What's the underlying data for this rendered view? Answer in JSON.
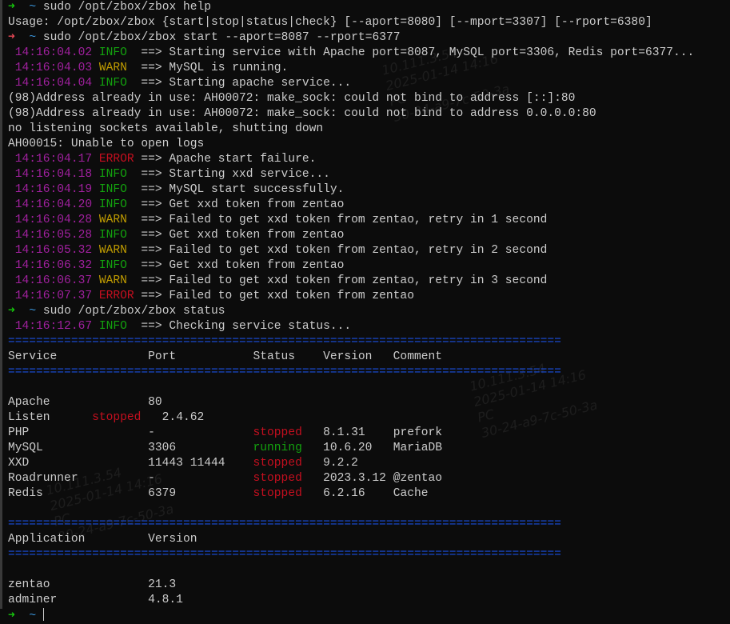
{
  "colors": {
    "background": "#0c0c0c",
    "text": "#cccccc",
    "timestamp": "#a0209e",
    "info": "#13a10e",
    "warn": "#c19c00",
    "error": "#c50f1f",
    "prompt_ok": "#16c60c",
    "prompt_fail": "#e74856",
    "separator": "#1a4fe0"
  },
  "watermark": [
    "10.111.3.54",
    "2025-01-14 14:16",
    "PC",
    "30-24-a9-7c-50-3a"
  ],
  "lines": [
    [
      {
        "c": "ok",
        "t": "➜"
      },
      {
        "c": "",
        "t": "  "
      },
      {
        "c": "cyan",
        "t": "~"
      },
      {
        "c": "",
        "t": " sudo /opt/zbox/zbox help"
      }
    ],
    [
      {
        "c": "",
        "t": "Usage: /opt/zbox/zbox {start|stop|status|check} [--aport=8080] [--mport=3307] [--rport=6380]"
      }
    ],
    [
      {
        "c": "fail",
        "t": "➜"
      },
      {
        "c": "",
        "t": "  "
      },
      {
        "c": "cyan",
        "t": "~"
      },
      {
        "c": "",
        "t": " sudo /opt/zbox/zbox start --aport=8087 --rport=6377"
      }
    ],
    [
      {
        "c": "ts",
        "t": " 14:16:04.02"
      },
      {
        "c": "info",
        "t": " INFO "
      },
      {
        "c": "",
        "t": " ==> Starting service with Apache port=8087, MySQL port=3306, Redis port=6377..."
      }
    ],
    [
      {
        "c": "ts",
        "t": " 14:16:04.03"
      },
      {
        "c": "warn",
        "t": " WARN "
      },
      {
        "c": "",
        "t": " ==> MySQL is running."
      }
    ],
    [
      {
        "c": "ts",
        "t": " 14:16:04.04"
      },
      {
        "c": "info",
        "t": " INFO "
      },
      {
        "c": "",
        "t": " ==> Starting apache service..."
      }
    ],
    [
      {
        "c": "",
        "t": "(98)Address already in use: AH00072: make_sock: could not bind to address [::]:80"
      }
    ],
    [
      {
        "c": "",
        "t": "(98)Address already in use: AH00072: make_sock: could not bind to address 0.0.0.0:80"
      }
    ],
    [
      {
        "c": "",
        "t": "no listening sockets available, shutting down"
      }
    ],
    [
      {
        "c": "",
        "t": "AH00015: Unable to open logs"
      }
    ],
    [
      {
        "c": "ts",
        "t": " 14:16:04.17"
      },
      {
        "c": "error",
        "t": " ERROR"
      },
      {
        "c": "",
        "t": " ==> Apache start failure."
      }
    ],
    [
      {
        "c": "ts",
        "t": " 14:16:04.18"
      },
      {
        "c": "info",
        "t": " INFO "
      },
      {
        "c": "",
        "t": " ==> Starting xxd service..."
      }
    ],
    [
      {
        "c": "ts",
        "t": " 14:16:04.19"
      },
      {
        "c": "info",
        "t": " INFO "
      },
      {
        "c": "",
        "t": " ==> MySQL start successfully."
      }
    ],
    [
      {
        "c": "ts",
        "t": " 14:16:04.20"
      },
      {
        "c": "info",
        "t": " INFO "
      },
      {
        "c": "",
        "t": " ==> Get xxd token from zentao"
      }
    ],
    [
      {
        "c": "ts",
        "t": " 14:16:04.28"
      },
      {
        "c": "warn",
        "t": " WARN "
      },
      {
        "c": "",
        "t": " ==> Failed to get xxd token from zentao, retry in 1 second"
      }
    ],
    [
      {
        "c": "ts",
        "t": " 14:16:05.28"
      },
      {
        "c": "info",
        "t": " INFO "
      },
      {
        "c": "",
        "t": " ==> Get xxd token from zentao"
      }
    ],
    [
      {
        "c": "ts",
        "t": " 14:16:05.32"
      },
      {
        "c": "warn",
        "t": " WARN "
      },
      {
        "c": "",
        "t": " ==> Failed to get xxd token from zentao, retry in 2 second"
      }
    ],
    [
      {
        "c": "ts",
        "t": " 14:16:06.32"
      },
      {
        "c": "info",
        "t": " INFO "
      },
      {
        "c": "",
        "t": " ==> Get xxd token from zentao"
      }
    ],
    [
      {
        "c": "ts",
        "t": " 14:16:06.37"
      },
      {
        "c": "warn",
        "t": " WARN "
      },
      {
        "c": "",
        "t": " ==> Failed to get xxd token from zentao, retry in 3 second"
      }
    ],
    [
      {
        "c": "ts",
        "t": " 14:16:07.37"
      },
      {
        "c": "error",
        "t": " ERROR"
      },
      {
        "c": "",
        "t": " ==> Failed to get xxd token from zentao"
      }
    ],
    [
      {
        "c": "ok",
        "t": "➜"
      },
      {
        "c": "",
        "t": "  "
      },
      {
        "c": "cyan",
        "t": "~"
      },
      {
        "c": "",
        "t": " sudo /opt/zbox/zbox status"
      }
    ],
    [
      {
        "c": "ts",
        "t": " 14:16:12.67"
      },
      {
        "c": "info",
        "t": " INFO "
      },
      {
        "c": "",
        "t": " ==> Checking service status..."
      }
    ],
    [
      {
        "c": "sep",
        "t": "==============================================================================="
      }
    ],
    [
      {
        "c": "",
        "t": "Service             Port           Status    Version   Comment"
      }
    ],
    [
      {
        "c": "sep",
        "t": "==============================================================================="
      }
    ],
    [
      {
        "c": "",
        "t": ""
      }
    ],
    [
      {
        "c": "",
        "t": "Apache              80"
      }
    ],
    [
      {
        "c": "",
        "t": "Listen      "
      },
      {
        "c": "stop",
        "t": "stopped"
      },
      {
        "c": "",
        "t": "   2.4.62"
      }
    ],
    [
      {
        "c": "",
        "t": "PHP                 -              "
      },
      {
        "c": "stop",
        "t": "stopped"
      },
      {
        "c": "",
        "t": "   8.1.31    prefork"
      }
    ],
    [
      {
        "c": "",
        "t": "MySQL               3306           "
      },
      {
        "c": "run",
        "t": "running"
      },
      {
        "c": "",
        "t": "   10.6.20   MariaDB"
      }
    ],
    [
      {
        "c": "",
        "t": "XXD                 11443 11444    "
      },
      {
        "c": "stop",
        "t": "stopped"
      },
      {
        "c": "",
        "t": "   9.2.2"
      }
    ],
    [
      {
        "c": "",
        "t": "Roadrunner          -              "
      },
      {
        "c": "stop",
        "t": "stopped"
      },
      {
        "c": "",
        "t": "   2023.3.12 @zentao"
      }
    ],
    [
      {
        "c": "",
        "t": "Redis               6379           "
      },
      {
        "c": "stop",
        "t": "stopped"
      },
      {
        "c": "",
        "t": "   6.2.16    Cache"
      }
    ],
    [
      {
        "c": "",
        "t": ""
      }
    ],
    [
      {
        "c": "sep",
        "t": "==============================================================================="
      }
    ],
    [
      {
        "c": "",
        "t": "Application         Version"
      }
    ],
    [
      {
        "c": "sep",
        "t": "==============================================================================="
      }
    ],
    [
      {
        "c": "",
        "t": ""
      }
    ],
    [
      {
        "c": "",
        "t": "zentao              21.3"
      }
    ],
    [
      {
        "c": "",
        "t": "adminer             4.8.1"
      }
    ],
    [
      {
        "c": "ok",
        "t": "➜"
      },
      {
        "c": "",
        "t": "  "
      },
      {
        "c": "cyan",
        "t": "~"
      },
      {
        "c": "",
        "t": " "
      }
    ]
  ]
}
